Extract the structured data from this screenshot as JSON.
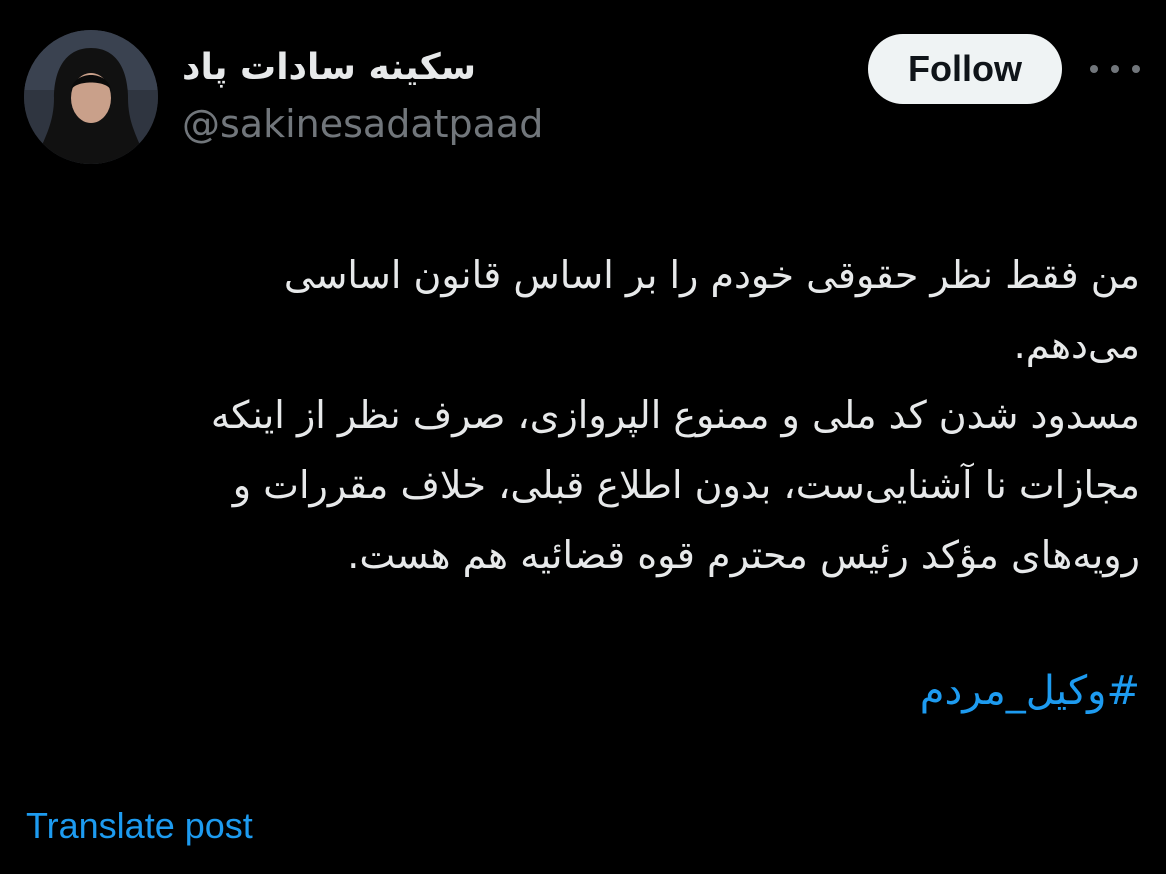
{
  "author": {
    "display_name": "سکینه سادات پاد",
    "handle": "@sakinesadatpaad"
  },
  "actions": {
    "follow_label": "Follow",
    "more_icon": "more-horizontal-icon"
  },
  "post": {
    "lines": [
      "من فقط نظر حقوقی خودم را بر اساس قانون اساسی",
      "می‌دهم.",
      "مسدود شدن کد ملی و ممنوع الپروازی، صرف نظر از اینکه",
      "مجازات نا آشنایی‌ست، بدون اطلاع قبلی، خلاف مقررات و",
      "رویه‌های مؤکد رئیس محترم قوه قضائیه هم هست."
    ],
    "hashtag": "#وکیل_مردم"
  },
  "footer": {
    "translate_label": "Translate post"
  },
  "colors": {
    "background": "#000000",
    "text": "#e7e9ea",
    "secondary": "#71767b",
    "link": "#1d9bf0",
    "follow_bg": "#eff3f4"
  }
}
